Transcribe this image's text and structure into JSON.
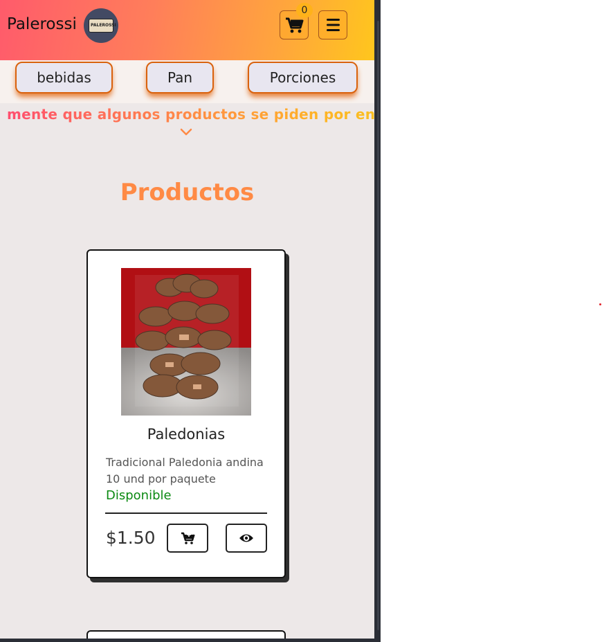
{
  "header": {
    "brand": "Palerossi",
    "logo_text": "PALEROSSI",
    "cart_count": "0",
    "icons": [
      "shopping-cart-icon",
      "hamburger-menu-icon"
    ]
  },
  "categories": [
    {
      "label": "bebidas"
    },
    {
      "label": "Pan"
    },
    {
      "label": "Porciones"
    }
  ],
  "notice": {
    "text": "mente que algunos productos se piden por encargo"
  },
  "main": {
    "title": "Productos"
  },
  "products": [
    {
      "name": "Paledonias",
      "description_line1": "Tradicional Paledonia andina",
      "description_line2": "10 und por paquete",
      "status": "Disponible",
      "price": "$1.50"
    }
  ],
  "colors": {
    "header_gradient": [
      "#ff5b6b",
      "#ffa63c",
      "#ffc61d"
    ],
    "accent_orange": "#ff8a45",
    "status_green": "#0b8a12",
    "button_border": "#d9620d",
    "page_bg": "#ede8e8"
  }
}
